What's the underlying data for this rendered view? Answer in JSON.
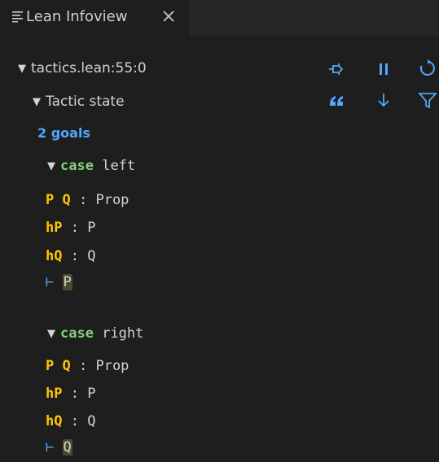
{
  "tab": {
    "title": "Lean Infoview",
    "menu_icon": "list-icon",
    "close_icon": "close-icon"
  },
  "location": {
    "label": "tactics.lean:55:0"
  },
  "tactic_state": {
    "label": "Tactic state",
    "goals_count": "2 goals"
  },
  "toolbar": {
    "icons": [
      "pin-icon",
      "pause-icon",
      "refresh-icon",
      "copy-to-comment-icon",
      "scroll-down-icon",
      "filter-icon"
    ]
  },
  "goals": [
    {
      "case_keyword": "case",
      "case_name": "left",
      "hyp1_names": "P Q",
      "hyp1_type": "Prop",
      "hyp2_name": "hP",
      "hyp2_type": "P",
      "hyp3_name": "hQ",
      "hyp3_type": "Q",
      "turnstile": "⊢",
      "target": "P"
    },
    {
      "case_keyword": "case",
      "case_name": "right",
      "hyp1_names": "P Q",
      "hyp1_type": "Prop",
      "hyp2_name": "hP",
      "hyp2_type": "P",
      "hyp3_name": "hQ",
      "hyp3_type": "Q",
      "turnstile": "⊢",
      "target": "Q"
    }
  ],
  "colors": {
    "background": "#1e1e1e",
    "accent_blue": "#4fa8ff",
    "hypothesis_yellow": "#ffc600",
    "keyword_green": "#7fd07a"
  },
  "separator": ":"
}
